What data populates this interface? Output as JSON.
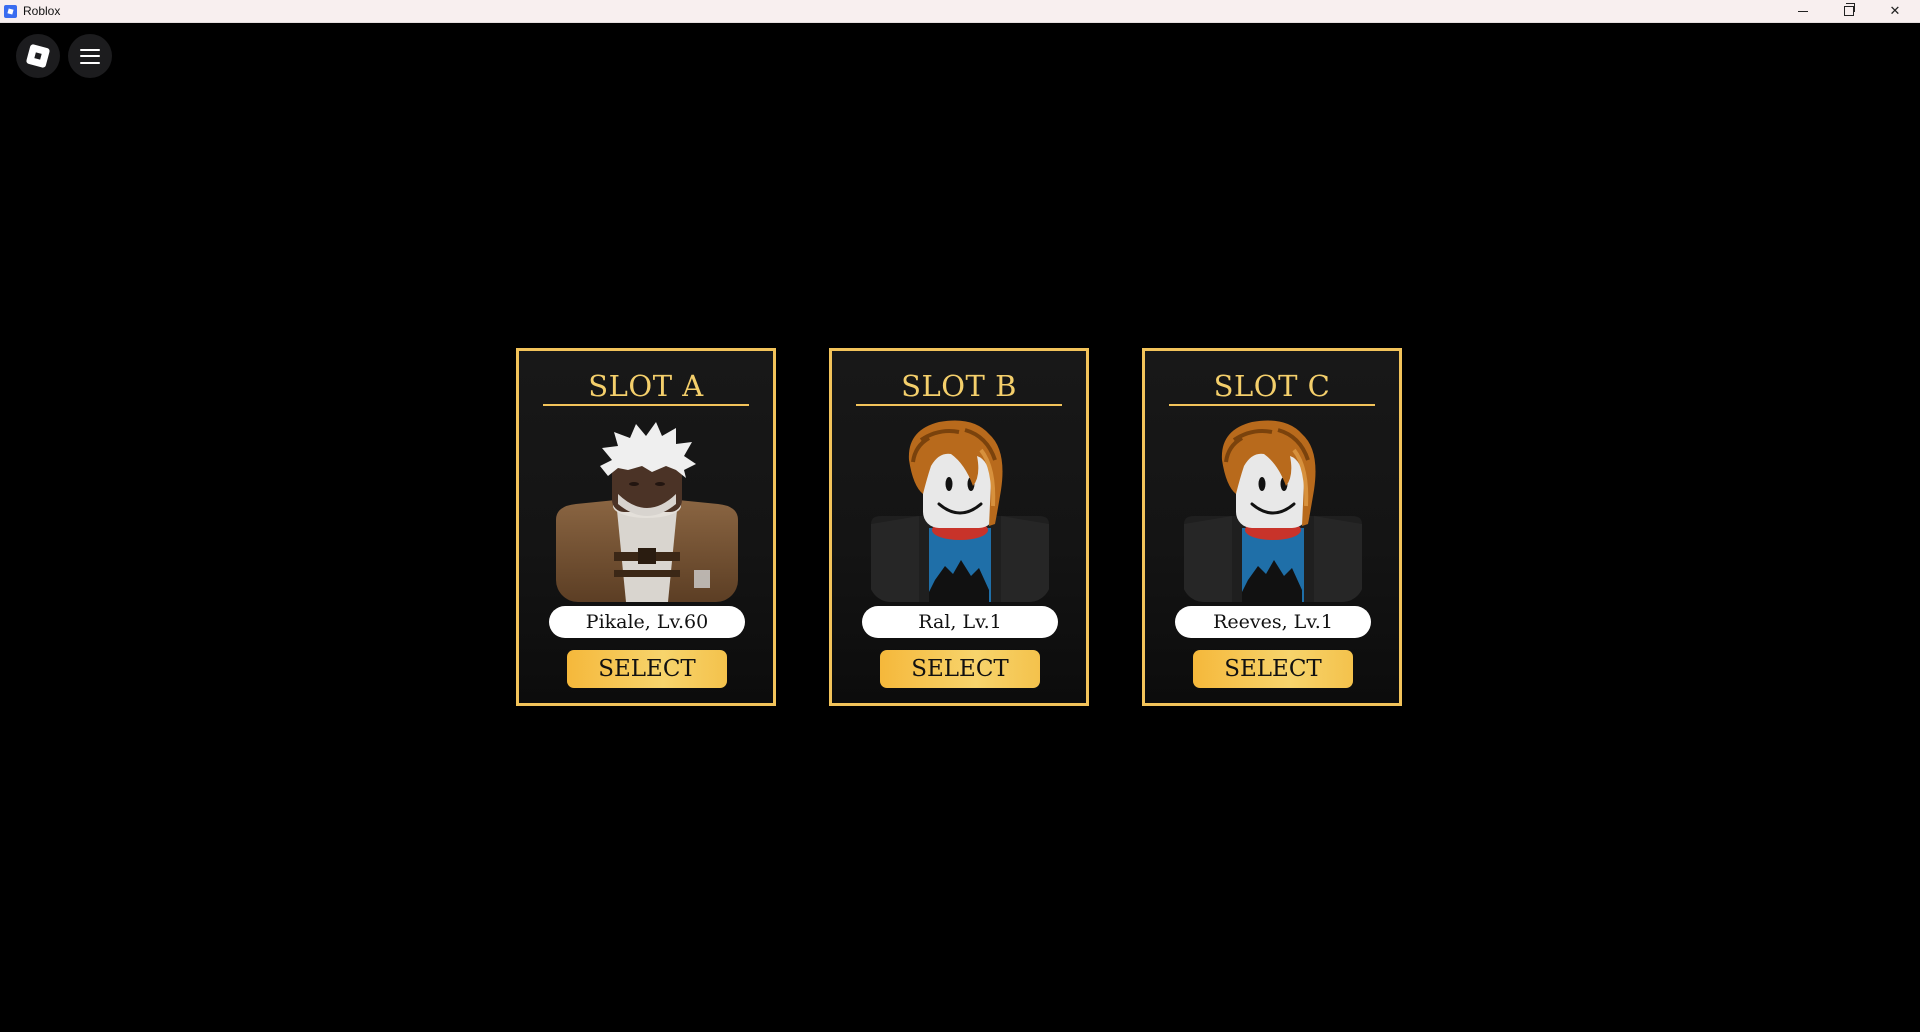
{
  "window": {
    "title": "Roblox",
    "minimize_glyph": "─",
    "maximize_glyph": "❐",
    "close_glyph": "✕"
  },
  "topbar": {
    "roblox_button_icon": "roblox-logo-icon",
    "menu_button_icon": "hamburger-menu-icon"
  },
  "theme": {
    "accent": "#f2c35a",
    "title_color": "#f4cf6b",
    "button_gradient": [
      "#f5b83b",
      "#f7d46c"
    ],
    "background": "#000000"
  },
  "slots": [
    {
      "title": "SLOT A",
      "character": "Pikale, Lv.60",
      "button": "SELECT",
      "avatar": "white-haired-brown-jacket"
    },
    {
      "title": "SLOT B",
      "character": "Ral, Lv.1",
      "button": "SELECT",
      "avatar": "bacon-hair-default"
    },
    {
      "title": "SLOT C",
      "character": "Reeves, Lv.1",
      "button": "SELECT",
      "avatar": "bacon-hair-default"
    }
  ]
}
